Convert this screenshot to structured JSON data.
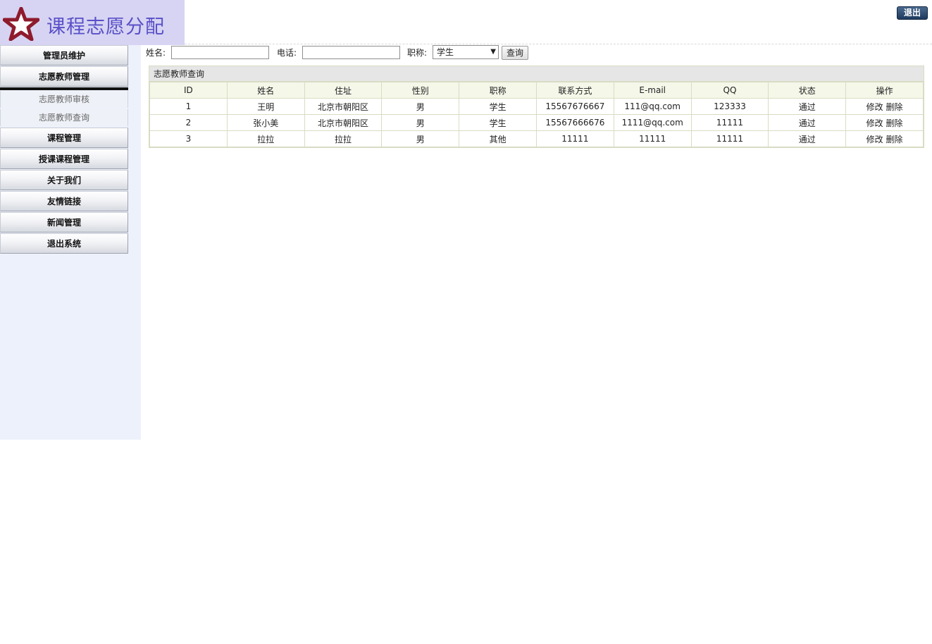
{
  "header": {
    "title": "课程志愿分配",
    "logout_label": "退出"
  },
  "sidebar": {
    "items": [
      {
        "label": "管理员维护"
      },
      {
        "label": "志愿教师管理"
      },
      {
        "label": "课程管理"
      },
      {
        "label": "授课课程管理"
      },
      {
        "label": "关于我们"
      },
      {
        "label": "友情链接"
      },
      {
        "label": "新闻管理"
      },
      {
        "label": "退出系统"
      }
    ],
    "submenu": [
      {
        "label": "志愿教师审核"
      },
      {
        "label": "志愿教师查询"
      }
    ]
  },
  "search": {
    "name_label": "姓名:",
    "name_value": "",
    "phone_label": "电话:",
    "phone_value": "",
    "title_label": "职称:",
    "title_selected": "学生",
    "query_label": "查询"
  },
  "panel": {
    "title": "志愿教师查询",
    "columns": [
      "ID",
      "姓名",
      "住址",
      "性别",
      "职称",
      "联系方式",
      "E-mail",
      "QQ",
      "状态",
      "操作"
    ],
    "rows": [
      {
        "id": "1",
        "name": "王明",
        "address": "北京市朝阳区",
        "gender": "男",
        "title": "学生",
        "phone": "15567676667",
        "email": "111@qq.com",
        "qq": "123333",
        "status": "通过",
        "edit": "修改",
        "delete": "删除"
      },
      {
        "id": "2",
        "name": "张小美",
        "address": "北京市朝阳区",
        "gender": "男",
        "title": "学生",
        "phone": "15567666676",
        "email": "1111@qq.com",
        "qq": "11111",
        "status": "通过",
        "edit": "修改",
        "delete": "删除"
      },
      {
        "id": "3",
        "name": "拉拉",
        "address": "拉拉",
        "gender": "男",
        "title": "其他",
        "phone": "11111",
        "email": "11111",
        "qq": "11111",
        "status": "通过",
        "edit": "修改",
        "delete": "删除"
      }
    ]
  },
  "icons": {
    "logo": "star-icon",
    "select": "chevron-down-icon"
  },
  "colors": {
    "brand_bg": "#d6d4f2",
    "brand_text": "#5a4fc8",
    "star": "#8e1b2d",
    "sidebar_bg": "#edf1fb",
    "logout_bg": "#1e3a5e"
  }
}
